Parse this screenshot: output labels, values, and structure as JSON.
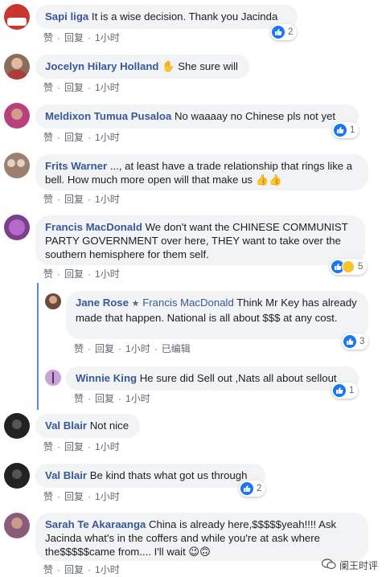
{
  "comments": [
    {
      "name": "Sapi liga",
      "text": "It is a wise decision. Thank you Jacinda",
      "like": "赞",
      "reply": "回复",
      "time": "1小时",
      "reactions": "2",
      "avatar_color": "#c8362f"
    },
    {
      "name": "Jocelyn Hilary Holland",
      "text": "✋ She sure will",
      "like": "赞",
      "reply": "回复",
      "time": "1小时",
      "avatar_color": "#8a6d5a"
    },
    {
      "name": "Meldixon Tumua Pusaloa",
      "text": "No waaaay no Chinese pls not yet",
      "like": "赞",
      "reply": "回复",
      "time": "1小时",
      "reactions": "1",
      "avatar_color": "#b7417a"
    },
    {
      "name": "Frits Warner",
      "text": "..., at least have a trade relationship that rings like a bell. How much more open will that make us 👍👍",
      "like": "赞",
      "reply": "回复",
      "time": "1小时",
      "avatar_color": "#9a8070"
    },
    {
      "name": "Francis MacDonald",
      "text": "We don't want the CHINESE COMMUNIST PARTY GOVERNMENT over here, THEY want to take over the southern hemisphere for them self.",
      "like": "赞",
      "reply": "回复",
      "time": "1小时",
      "reactions": "5",
      "avatar_color": "#7b3f8c"
    },
    {
      "name": "Jane Rose",
      "mention": "Francis MacDonald",
      "text": "Think Mr Key has already made that happen. National is all about $$$ at any cost.",
      "like": "赞",
      "reply": "回复",
      "time": "1小时",
      "edited": "已编辑",
      "reactions": "3",
      "avatar_color": "#6b4a3c"
    },
    {
      "name": "Winnie King",
      "text": "He sure did Sell out ,Nats all about sellout",
      "like": "赞",
      "reply": "回复",
      "time": "1小时",
      "reactions": "1",
      "avatar_color": "#c9a3d6"
    },
    {
      "name": "Val Blair",
      "text": "Not nice",
      "like": "赞",
      "reply": "回复",
      "time": "1小时",
      "avatar_color": "#222222"
    },
    {
      "name": "Val Blair",
      "text": "Be kind thats what got us through",
      "like": "赞",
      "reply": "回复",
      "time": "1小时",
      "reactions": "2",
      "avatar_color": "#222222"
    },
    {
      "name": "Sarah Te Akaraanga",
      "text": "China is already here,$$$$$yeah!!!! Ask Jacinda what's in the coffers and while you're at ask where the$$$$$came from.... I'll wait 😉🙃",
      "like": "赞",
      "reply": "回复",
      "time": "1小时",
      "avatar_color": "#8a5c7a"
    }
  ],
  "watermark": {
    "text": "阑王时评",
    "icon": "wechat-icon"
  }
}
